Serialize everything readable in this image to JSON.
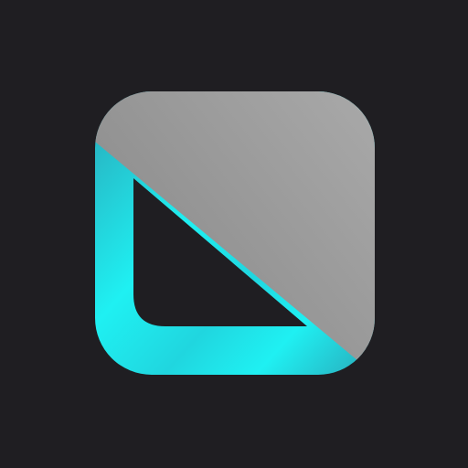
{
  "background_color": "#1f1e22",
  "icon": {
    "name": "app-logo-icon",
    "colors": {
      "gray_light": "#a9a9a9",
      "gray_dark": "#8a8a8a",
      "cyan_light": "#1ff0f2",
      "cyan_mid": "#20d6df",
      "cyan_dark": "#27b9c6",
      "inner": "#1f1e22"
    }
  }
}
